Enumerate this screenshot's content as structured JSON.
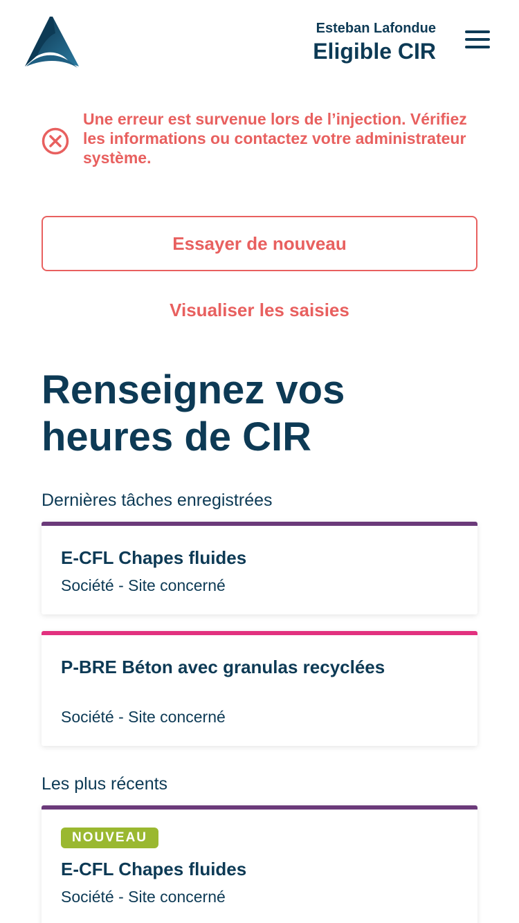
{
  "header": {
    "user_name": "Esteban Lafondue",
    "user_status": "Eligible CIR"
  },
  "error": {
    "message": "Une erreur est survenue lors de l’injection. Vérifiez les informations ou contactez votre administrateur système."
  },
  "actions": {
    "retry_label": "Essayer de nouveau",
    "view_label": "Visualiser les saisies"
  },
  "main": {
    "title": "Renseignez vos heures de CIR",
    "last_tasks_label": "Dernières tâches enregistrées",
    "recent_label": "Les plus récents"
  },
  "last_tasks": [
    {
      "title": "E-CFL Chapes fluides",
      "subtitle": "Société - Site concerné"
    },
    {
      "title": "P-BRE Béton avec granulas recyclées",
      "subtitle": "Société - Site concerné"
    }
  ],
  "recent": [
    {
      "badge": "NOUVEAU",
      "title": "E-CFL Chapes fluides",
      "subtitle": "Société - Site concerné"
    }
  ],
  "colors": {
    "primary": "#0d3a55",
    "error": "#e8605f",
    "card_purple": "#6b3a7a",
    "card_pink": "#e2317f",
    "badge_green": "#9ab830"
  },
  "icons": {
    "logo": "triangle-logo",
    "menu": "hamburger-menu-icon",
    "error": "close-circle-icon"
  }
}
